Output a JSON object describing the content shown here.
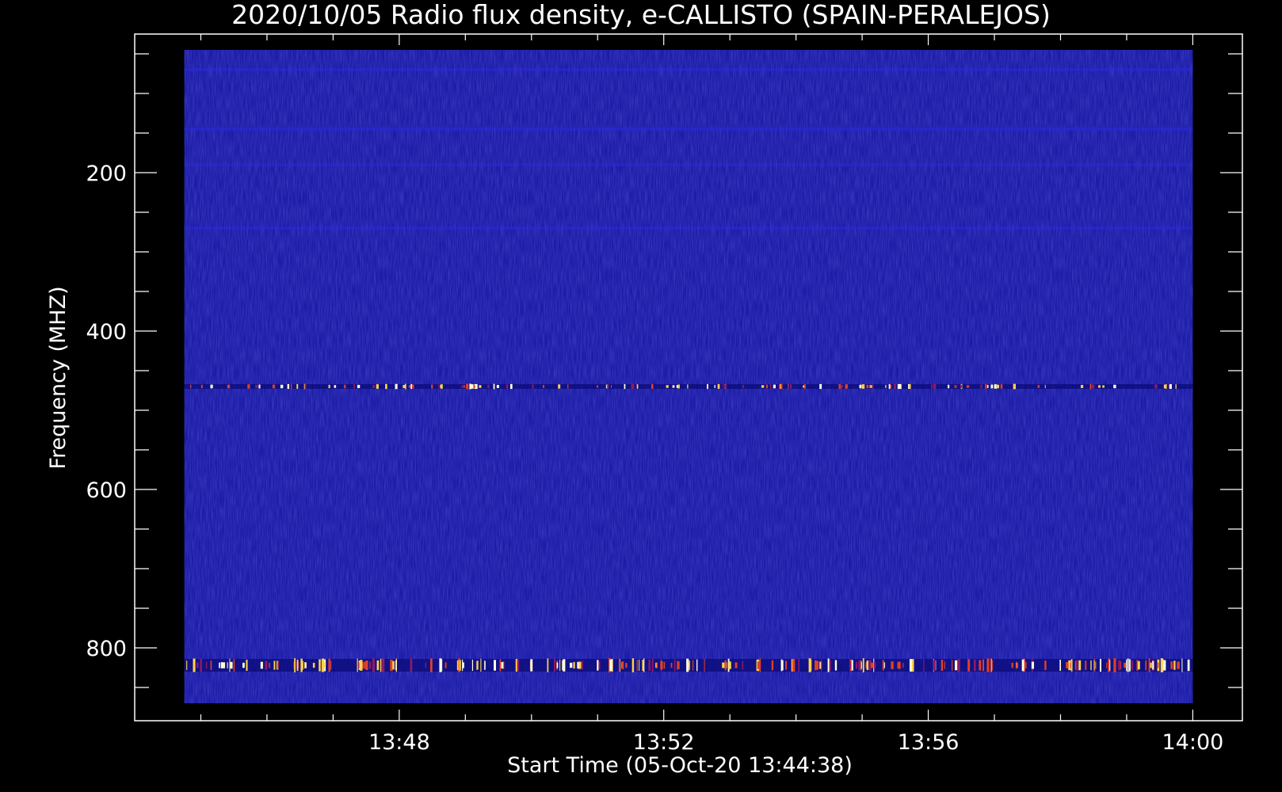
{
  "chart_data": {
    "type": "heatmap",
    "title": "2020/10/05  Radio flux density, e-CALLISTO (SPAIN-PERALEJOS)",
    "xlabel": "Start Time (05-Oct-20 13:44:38)",
    "ylabel": "Frequency (MHZ)",
    "x_ticks": [
      "13:48",
      "13:52",
      "13:56",
      "14:00"
    ],
    "y_ticks": [
      "200",
      "400",
      "600",
      "800"
    ],
    "xlim_minutes_after_13_00": [
      44.0,
      60.75
    ],
    "x_data_minutes_after_13_00": [
      44.75,
      60.0
    ],
    "ylim_mhz": [
      25,
      892
    ],
    "y_data_mhz": [
      45,
      870
    ],
    "colormap": {
      "background": "#1c1ca8",
      "low": "#0d0d7a",
      "high": "#ffffe0"
    },
    "bright_bands": [
      {
        "frequency_mhz": 470,
        "intensity": "moderate"
      },
      {
        "frequency_mhz": 822,
        "intensity": "strong"
      }
    ],
    "faint_bands_mhz": [
      70,
      145,
      190,
      270
    ]
  }
}
